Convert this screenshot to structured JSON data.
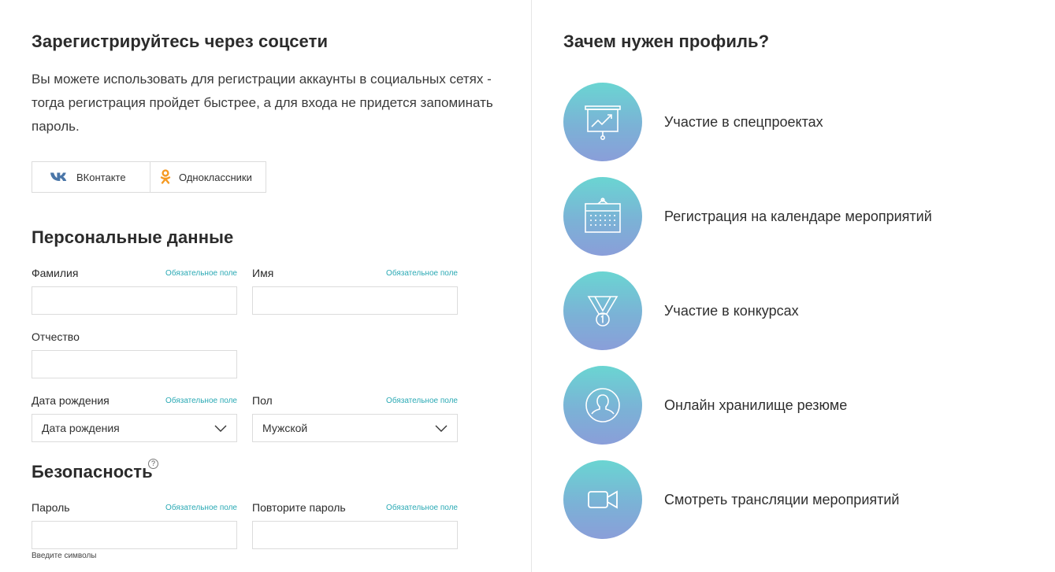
{
  "social": {
    "title": "Зарегистрируйтесь через соцсети",
    "description": "Вы можете использовать для регистрации аккаунты в социальных сетях - тогда регистрация пройдет быстрее, а для входа не придется запоминать пароль.",
    "buttons": [
      {
        "label": "ВКонтакте",
        "icon": "vk-icon"
      },
      {
        "label": "Одноклассники",
        "icon": "odnoklassniki-icon"
      }
    ]
  },
  "personal": {
    "title": "Персональные данные",
    "required_note": "Обязательное поле",
    "surname_label": "Фамилия",
    "surname_value": "",
    "name_label": "Имя",
    "name_value": "",
    "patronymic_label": "Отчество",
    "patronymic_value": "",
    "birthdate_label": "Дата рождения",
    "birthdate_value": "Дата рождения",
    "gender_label": "Пол",
    "gender_value": "Мужской"
  },
  "security": {
    "title": "Безопасность",
    "help_glyph": "?",
    "password_label": "Пароль",
    "password_hint": "Введите символы",
    "repeat_label": "Повторите пароль"
  },
  "profile": {
    "title": "Зачем нужен профиль?",
    "benefits": [
      {
        "label": "Участие в спецпроектах",
        "icon": "presentation-chart-icon"
      },
      {
        "label": "Регистрация на календаре мероприятий",
        "icon": "calendar-icon"
      },
      {
        "label": "Участие в конкурсах",
        "icon": "medal-icon"
      },
      {
        "label": "Онлайн хранилище резюме",
        "icon": "user-avatar-icon"
      },
      {
        "label": "Смотреть трансляции мероприятий",
        "icon": "video-camera-icon"
      }
    ]
  },
  "colors": {
    "accent": "#2aa9b4",
    "vk": "#4a76a8",
    "ok": "#f59a23",
    "gradient_top": "#6ad5d2",
    "gradient_bottom": "#8a9ed9"
  }
}
